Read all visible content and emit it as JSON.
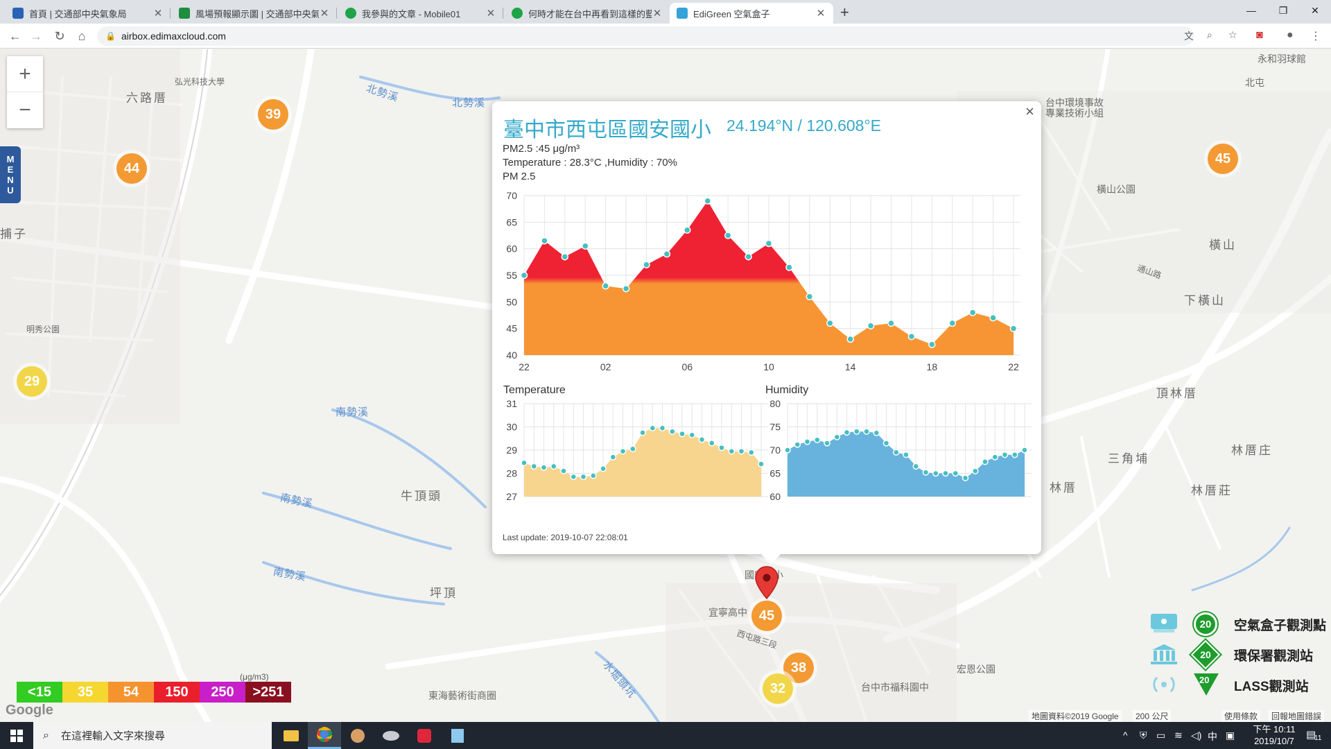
{
  "browser": {
    "tabs": [
      {
        "title": "首頁 | 交通部中央氣象局",
        "favicon": "eye-icon",
        "color": "#2a63b5"
      },
      {
        "title": "風場預報顯示圖 | 交通部中央氣象局",
        "favicon": "sheet-icon",
        "color": "#1e8e3e"
      },
      {
        "title": "我參與的文章 - Mobile01",
        "favicon": "mobile01-icon",
        "color": "#1ea446"
      },
      {
        "title": "何時才能在台中再看到這樣的藍天",
        "favicon": "mobile01-icon",
        "color": "#1ea446"
      },
      {
        "title": "EdiGreen 空氣盒子",
        "favicon": "edigreen-icon",
        "color": "#36a3d9"
      }
    ],
    "active_tab": 4,
    "url": "airbox.edimaxcloud.com"
  },
  "map": {
    "labels": [
      {
        "text": "六路厝"
      },
      {
        "text": "弘光科技大學"
      },
      {
        "text": "北勢溪"
      },
      {
        "text": "北勢溪"
      },
      {
        "text": "明秀公園"
      },
      {
        "text": "南勢溪"
      },
      {
        "text": "南勢溪"
      },
      {
        "text": "南勢溪"
      },
      {
        "text": "牛頂頭"
      },
      {
        "text": "坪頂"
      },
      {
        "text": "東海藝術街商圈"
      },
      {
        "text": "宜寧高中"
      },
      {
        "text": "西屯路三段"
      },
      {
        "text": "宏恩公園"
      },
      {
        "text": "台中市福科園中"
      },
      {
        "text": "水堀頭坑"
      },
      {
        "text": "橫山"
      },
      {
        "text": "下橫山"
      },
      {
        "text": "頂林厝"
      },
      {
        "text": "林厝庄"
      },
      {
        "text": "三角埔"
      },
      {
        "text": "林厝"
      },
      {
        "text": "林厝莊"
      },
      {
        "text": "台中環境事故專業技術小組"
      },
      {
        "text": "橫山公園"
      },
      {
        "text": "永和羽球館"
      },
      {
        "text": "國安國小"
      },
      {
        "text": "北屯"
      },
      {
        "text": "捕子"
      },
      {
        "text": "通山路"
      }
    ],
    "clusters": [
      {
        "value": "39",
        "color": "#f39a33"
      },
      {
        "value": "44",
        "color": "#f39a33"
      },
      {
        "value": "45",
        "color": "#f39a33"
      },
      {
        "value": "29",
        "color": "#f2d64a"
      },
      {
        "value": "45",
        "color": "#f39a33"
      },
      {
        "value": "38",
        "color": "#f39a33"
      },
      {
        "value": "32",
        "color": "#f2d64a"
      }
    ],
    "zoom_in": "+",
    "zoom_out": "−",
    "menu": [
      "M",
      "E",
      "N",
      "U"
    ],
    "aq_legend": [
      {
        "label": "<15",
        "color": "#33cc22"
      },
      {
        "label": "35",
        "color": "#f5d72f"
      },
      {
        "label": "54",
        "color": "#f5932f"
      },
      {
        "label": "150",
        "color": "#ea1f2c"
      },
      {
        "label": "250",
        "color": "#c81fc8"
      },
      {
        "label": ">251",
        "color": "#8a1020"
      }
    ],
    "aq_unit": "(μg/m3)",
    "google_logo": "Google",
    "attribution": [
      "地圖資料©2019 Google",
      "200 公尺",
      "使用條款",
      "回報地圖錯誤"
    ],
    "station_legend": [
      {
        "badge": "20",
        "label": "空氣盒子觀測點",
        "icon": "airbox-icon"
      },
      {
        "badge": "20",
        "label": "環保署觀測站",
        "icon": "epa-building-icon"
      },
      {
        "badge": "20",
        "label": "LASS觀測站",
        "icon": "lass-antenna-icon"
      }
    ]
  },
  "popup": {
    "title": "臺中市西屯區國安國小",
    "coords": "24.194°N / 120.608°E",
    "pm25_line": "PM2.5 :45 μg/m³",
    "temp_line": "Temperature : 28.3°C ,Humidity : 70%",
    "pm_caption": "PM 2.5",
    "temp_caption": "Temperature",
    "hum_caption": "Humidity",
    "last_update": "Last update: 2019-10-07 22:08:01",
    "close": "×"
  },
  "chart_data": [
    {
      "type": "area",
      "title": "PM 2.5",
      "x": [
        "22",
        "23",
        "00",
        "01",
        "02",
        "03",
        "04",
        "05",
        "06",
        "07",
        "08",
        "09",
        "10",
        "11",
        "12",
        "13",
        "14",
        "15",
        "16",
        "17",
        "18",
        "19",
        "20",
        "21",
        "22"
      ],
      "series": [
        {
          "values": [
            55,
            61.5,
            58.5,
            60.5,
            53,
            52.5,
            57,
            59,
            63.5,
            69,
            62.5,
            58.5,
            61,
            56.5,
            51,
            46,
            43,
            45.5,
            46,
            43.5,
            42,
            46,
            48,
            47,
            45
          ]
        }
      ],
      "xticks": [
        "22",
        "02",
        "06",
        "10",
        "14",
        "18",
        "22"
      ],
      "ylim": [
        40,
        70
      ],
      "yticks": [
        40,
        45,
        50,
        55,
        60,
        65,
        70
      ],
      "color_threshold": 54,
      "colors": {
        "above": "#ee2233",
        "below": "#f79534",
        "marker": "#45bfc0"
      }
    },
    {
      "type": "area",
      "title": "Temperature",
      "x": [
        "0",
        "1",
        "2",
        "3",
        "4",
        "5",
        "6",
        "7",
        "8",
        "9",
        "10",
        "11",
        "12",
        "13",
        "14",
        "15",
        "16",
        "17",
        "18",
        "19",
        "20",
        "21",
        "22",
        "23",
        "24"
      ],
      "series": [
        {
          "values": [
            28.45,
            28.3,
            28.25,
            28.3,
            28.1,
            27.85,
            27.85,
            27.9,
            28.2,
            28.7,
            28.95,
            29.05,
            29.75,
            29.95,
            29.95,
            29.8,
            29.7,
            29.65,
            29.45,
            29.3,
            29.1,
            28.95,
            28.95,
            28.9,
            28.4
          ]
        }
      ],
      "ylim": [
        27,
        31
      ],
      "yticks": [
        27,
        28,
        29,
        30,
        31
      ],
      "colors": {
        "fill": "#f7d58f",
        "marker": "#45bfc0"
      }
    },
    {
      "type": "area",
      "title": "Humidity",
      "x": [
        "0",
        "1",
        "2",
        "3",
        "4",
        "5",
        "6",
        "7",
        "8",
        "9",
        "10",
        "11",
        "12",
        "13",
        "14",
        "15",
        "16",
        "17",
        "18",
        "19",
        "20",
        "21",
        "22",
        "23",
        "24"
      ],
      "series": [
        {
          "values": [
            70,
            71.2,
            71.8,
            72.2,
            71.5,
            72.8,
            73.8,
            74,
            74,
            73.7,
            71.5,
            69.5,
            69,
            66.5,
            65.2,
            65,
            65,
            65,
            64,
            65.5,
            67.5,
            68.5,
            69,
            69,
            70
          ]
        }
      ],
      "ylim": [
        60,
        80
      ],
      "yticks": [
        60,
        65,
        70,
        75,
        80
      ],
      "colors": {
        "fill": "#68b3dd",
        "marker": "#45bfc0"
      }
    }
  ],
  "taskbar": {
    "search_placeholder": "在這裡輸入文字來搜尋",
    "time": "下午 10:11",
    "date": "2019/10/7",
    "ime": "中",
    "notif_count": "11"
  }
}
